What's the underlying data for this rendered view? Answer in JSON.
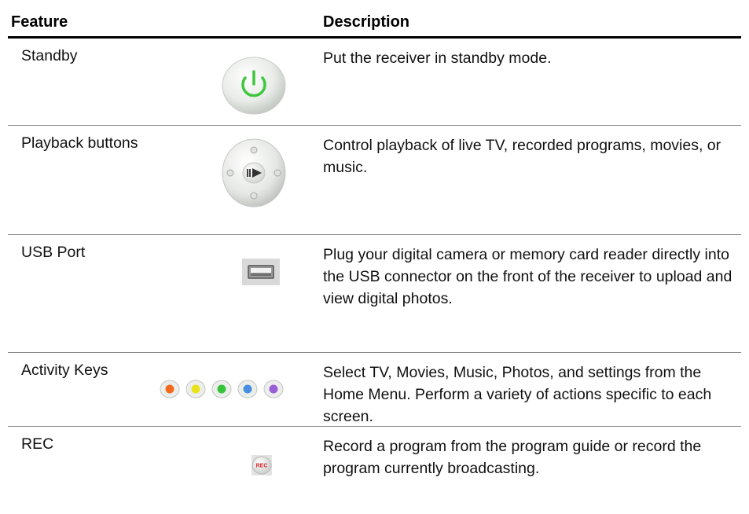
{
  "table": {
    "headers": {
      "feature": "Feature",
      "description": "Description"
    },
    "rows": [
      {
        "feature": "Standby",
        "description": "Put the receiver in standby mode.",
        "icon": "power-icon"
      },
      {
        "feature": "Playback buttons",
        "description": "Control playback of live TV, recorded programs, movies, or music.",
        "icon": "playback-pad-icon"
      },
      {
        "feature": "USB Port",
        "description": "Plug your digital camera or memory card reader directly into the USB connector on the front of the receiver to upload and view digital photos.",
        "icon": "usb-port-icon"
      },
      {
        "feature": "Activity Keys",
        "description": "Select TV, Movies, Music, Photos, and settings from the Home Menu. Perform a variety of actions specific to each screen.",
        "icon": "activity-keys-icon"
      },
      {
        "feature": "REC",
        "description": "Record a program from the program guide or record the program currently broadcasting.",
        "icon": "rec-button-icon"
      }
    ],
    "rec_badge_text": "REC",
    "activity_key_colors": [
      "#f26a1b",
      "#e8e21a",
      "#37c43a",
      "#4a8ee0",
      "#9a5fd8"
    ],
    "power_symbol_color": "#3ec73e",
    "rec_text_color": "#d9262c"
  }
}
